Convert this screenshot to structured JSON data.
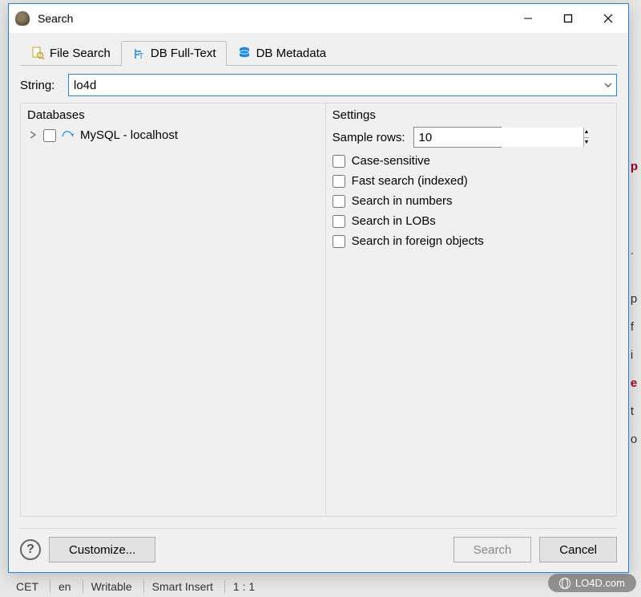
{
  "background": {
    "right_fragments": [
      "p",
      ".",
      "p",
      "f",
      "i",
      "e",
      "t",
      "o"
    ],
    "status_items": [
      "CET",
      "en",
      "Writable",
      "Smart Insert",
      "1 : 1"
    ]
  },
  "window": {
    "title": "Search",
    "tabs": [
      {
        "label": "File Search"
      },
      {
        "label": "DB Full-Text"
      },
      {
        "label": "DB Metadata"
      }
    ],
    "string_label": "String:",
    "string_value": "lo4d",
    "databases": {
      "title": "Databases",
      "items": [
        {
          "label": "MySQL - localhost",
          "checked": false
        }
      ]
    },
    "settings": {
      "title": "Settings",
      "sample_rows_label": "Sample rows:",
      "sample_rows_value": "10",
      "checks": [
        {
          "label": "Case-sensitive",
          "checked": false
        },
        {
          "label": "Fast search (indexed)",
          "checked": false
        },
        {
          "label": "Search in numbers",
          "checked": false
        },
        {
          "label": "Search in LOBs",
          "checked": false
        },
        {
          "label": "Search in foreign objects",
          "checked": false
        }
      ]
    },
    "buttons": {
      "customize": "Customize...",
      "search": "Search",
      "cancel": "Cancel"
    }
  },
  "watermark": "LO4D.com"
}
